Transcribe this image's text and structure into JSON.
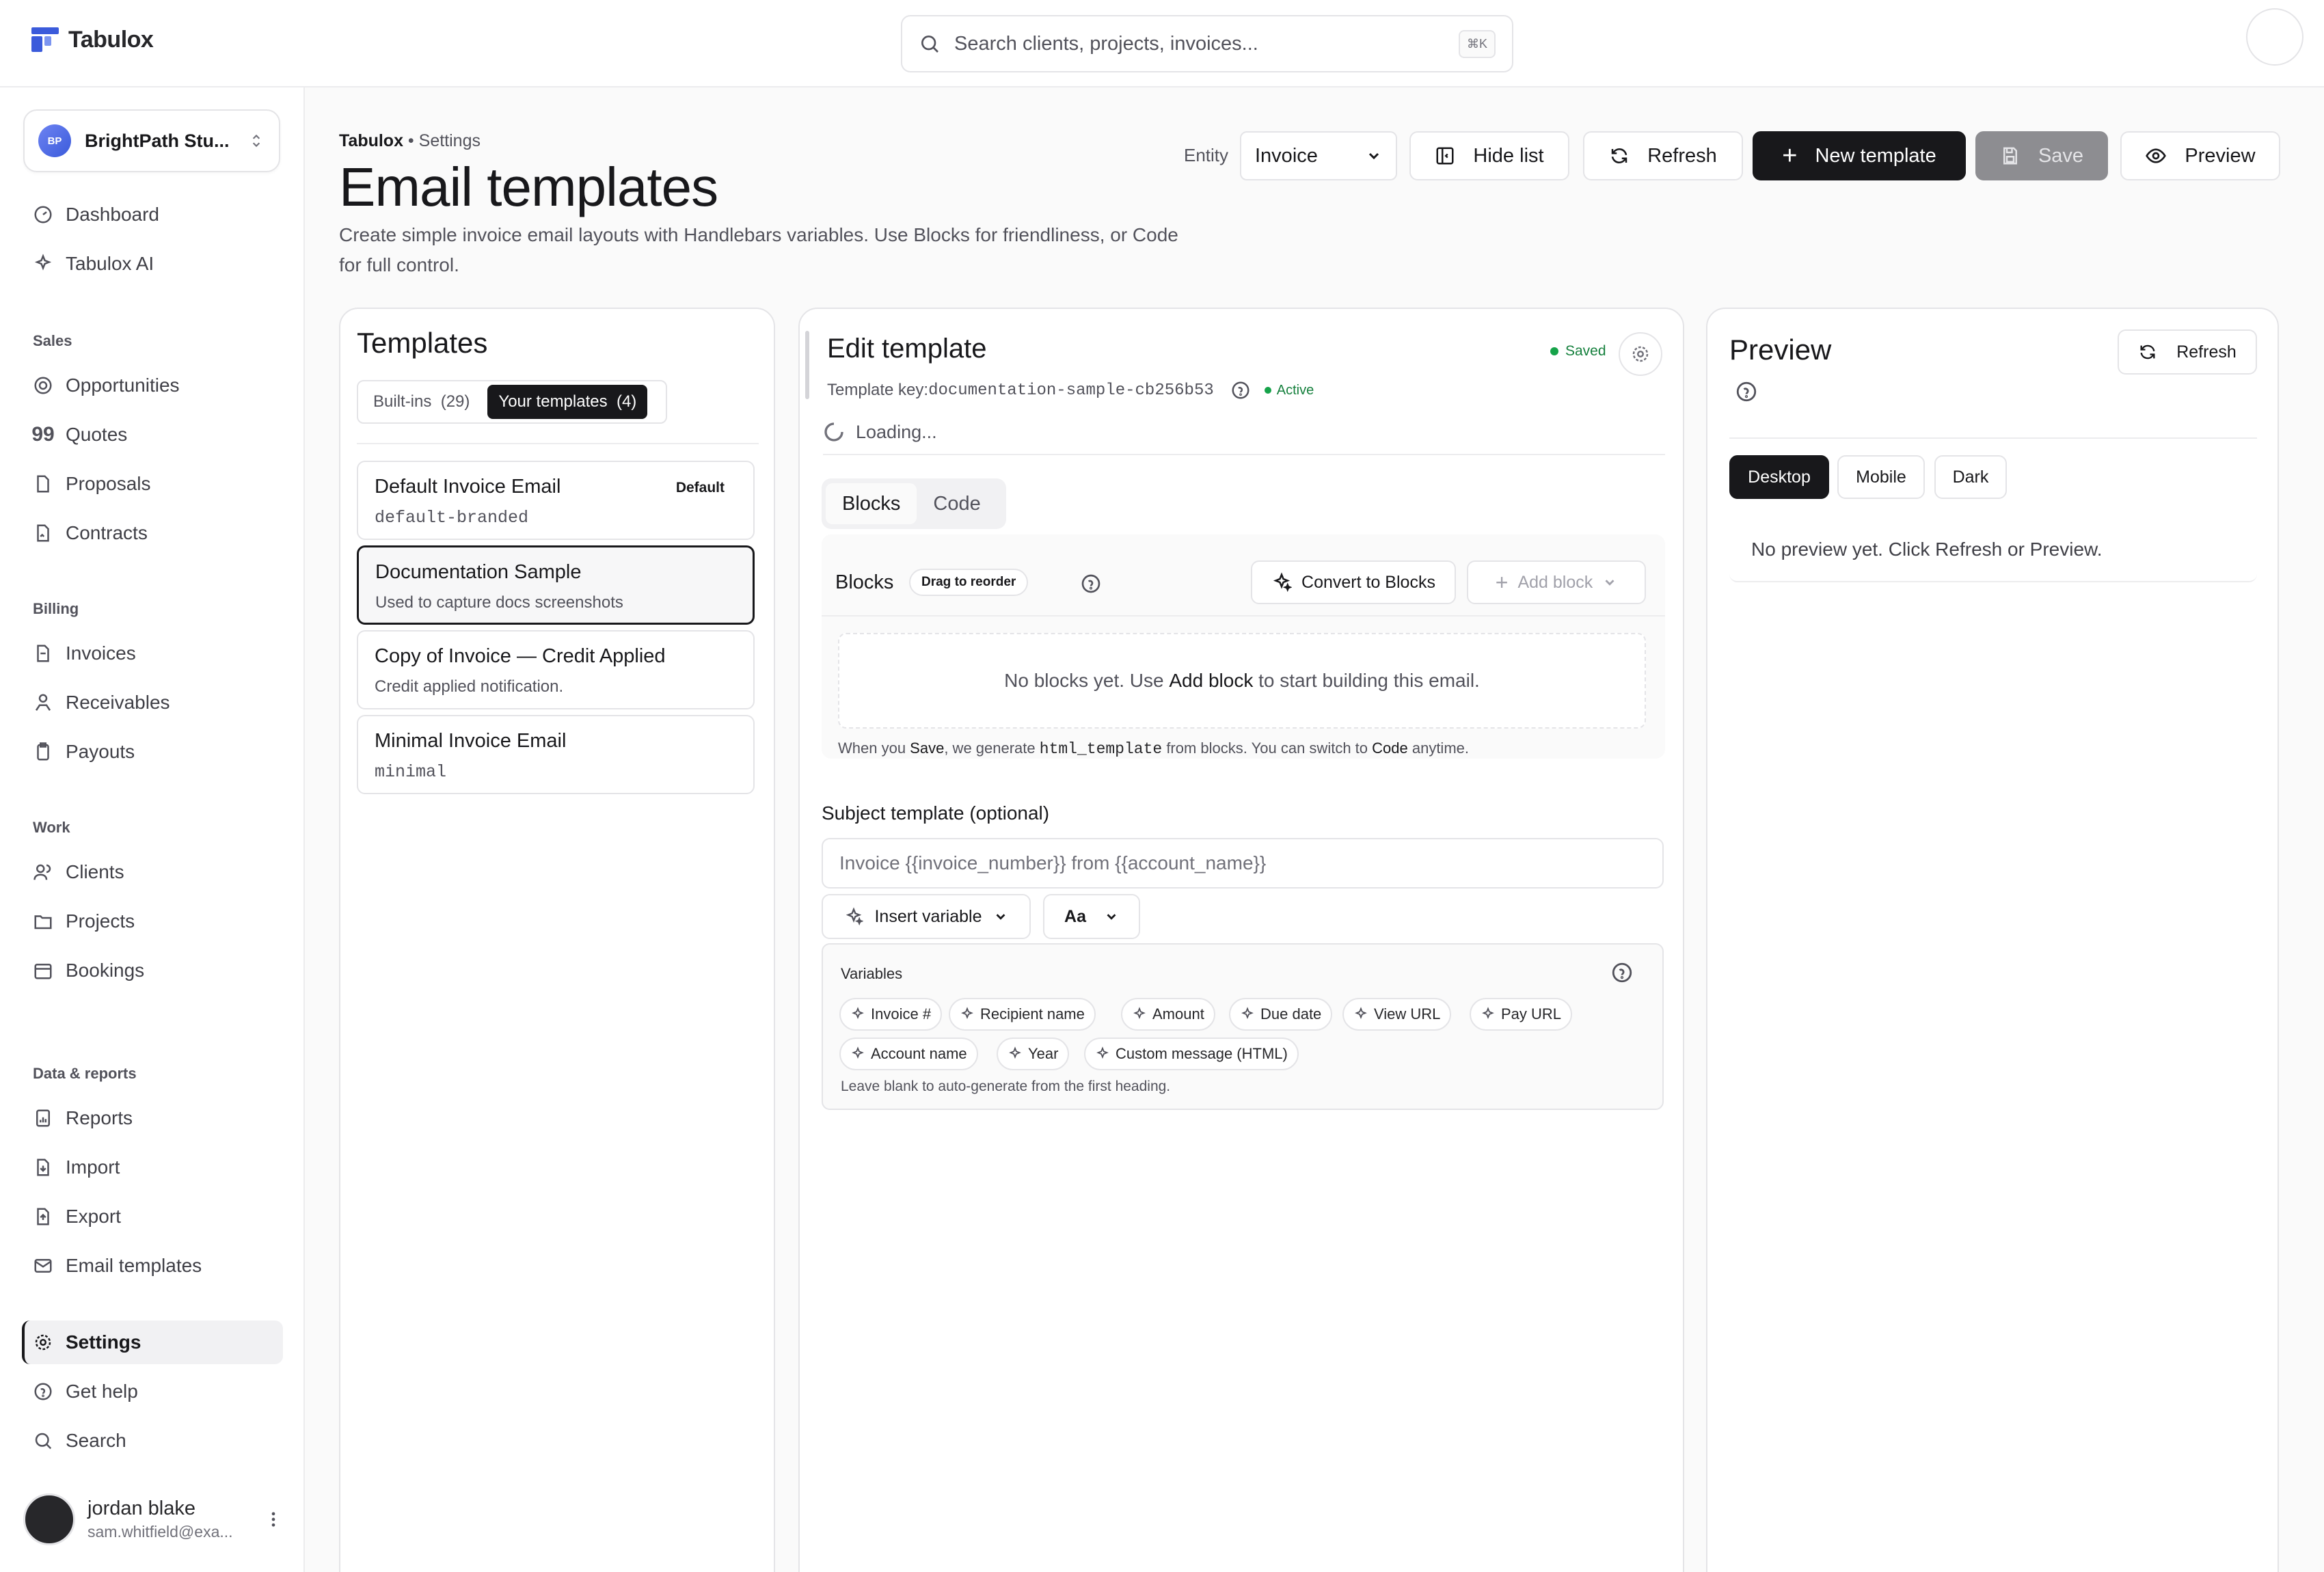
{
  "app": {
    "name": "Tabulox"
  },
  "search": {
    "placeholder": "Search clients, projects, invoices...",
    "shortcut": "⌘K"
  },
  "workspace": {
    "initials": "BP",
    "name": "BrightPath Stu..."
  },
  "sidebar": {
    "top": [
      {
        "label": "Dashboard"
      },
      {
        "label": "Tabulox AI"
      }
    ],
    "sections": [
      {
        "title": "Sales",
        "items": [
          "Opportunities",
          "Quotes",
          "Proposals",
          "Contracts"
        ]
      },
      {
        "title": "Billing",
        "items": [
          "Invoices",
          "Receivables",
          "Payouts"
        ]
      },
      {
        "title": "Work",
        "items": [
          "Clients",
          "Projects",
          "Bookings"
        ]
      },
      {
        "title": "Data & reports",
        "items": [
          "Reports",
          "Import",
          "Export",
          "Email templates"
        ]
      }
    ],
    "bottom": [
      "Settings",
      "Get help",
      "Search"
    ],
    "active": "Settings"
  },
  "user": {
    "name": "jordan blake",
    "email": "sam.whitfield@exa..."
  },
  "header": {
    "breadcrumb_root": "Tabulox",
    "breadcrumb_sep": " • ",
    "breadcrumb_leaf": "Settings",
    "title": "Email templates",
    "description": "Create simple invoice email layouts with Handlebars variables. Use Blocks for friendliness, or Code for full control."
  },
  "toolbar": {
    "entity_label": "Entity",
    "entity_value": "Invoice",
    "hide_list": "Hide list",
    "refresh": "Refresh",
    "new_template": "New template",
    "save": "Save",
    "preview": "Preview"
  },
  "templates": {
    "title": "Templates",
    "tab_builtins": "Built-ins",
    "tab_builtins_count": "(29)",
    "tab_yours": "Your templates",
    "tab_yours_count": "(4)",
    "items": [
      {
        "name": "Default Invoice Email",
        "sub": "default-branded",
        "tag": "Default"
      },
      {
        "name": "Documentation Sample",
        "sub": "Used to capture docs screenshots"
      },
      {
        "name": "Copy of Invoice — Credit Applied",
        "sub": "Credit applied notification."
      },
      {
        "name": "Minimal Invoice Email",
        "sub": "minimal"
      }
    ]
  },
  "editor": {
    "title": "Edit template",
    "saved": "Saved",
    "key_label": "Template key:",
    "key_value": "documentation-sample-cb256b53",
    "status": "Active",
    "loading": "Loading...",
    "mode_blocks": "Blocks",
    "mode_code": "Code",
    "blocks_label": "Blocks",
    "drag_hint": "Drag to reorder",
    "convert": "Convert to Blocks",
    "add_block": "Add block",
    "empty_pre": "No blocks yet. Use ",
    "empty_bold": "Add block",
    "empty_post": " to start building this email.",
    "note_1": "When you ",
    "note_save": "Save",
    "note_2": ", we generate ",
    "note_code": "html_template",
    "note_3": " from blocks. You can switch to ",
    "note_codeword": "Code",
    "note_4": " anytime.",
    "subject_label": "Subject template (optional)",
    "subject_value": "Invoice {{invoice_number}} from {{account_name}}",
    "insert_variable": "Insert variable",
    "font_button": "Aa",
    "variables_title": "Variables",
    "variables": [
      "Invoice #",
      "Recipient name",
      "Amount",
      "Due date",
      "View URL",
      "Pay URL",
      "Account name",
      "Year",
      "Custom message (HTML)"
    ],
    "variables_hint": "Leave blank to auto-generate from the first heading."
  },
  "preview": {
    "title": "Preview",
    "refresh": "Refresh",
    "modes": [
      "Desktop",
      "Mobile",
      "Dark"
    ],
    "active_mode": "Desktop",
    "empty": "No preview yet. Click Refresh or Preview."
  },
  "colors": {
    "accent": "#18181b",
    "success": "#16a34a",
    "brand": "#3b5bdb"
  }
}
